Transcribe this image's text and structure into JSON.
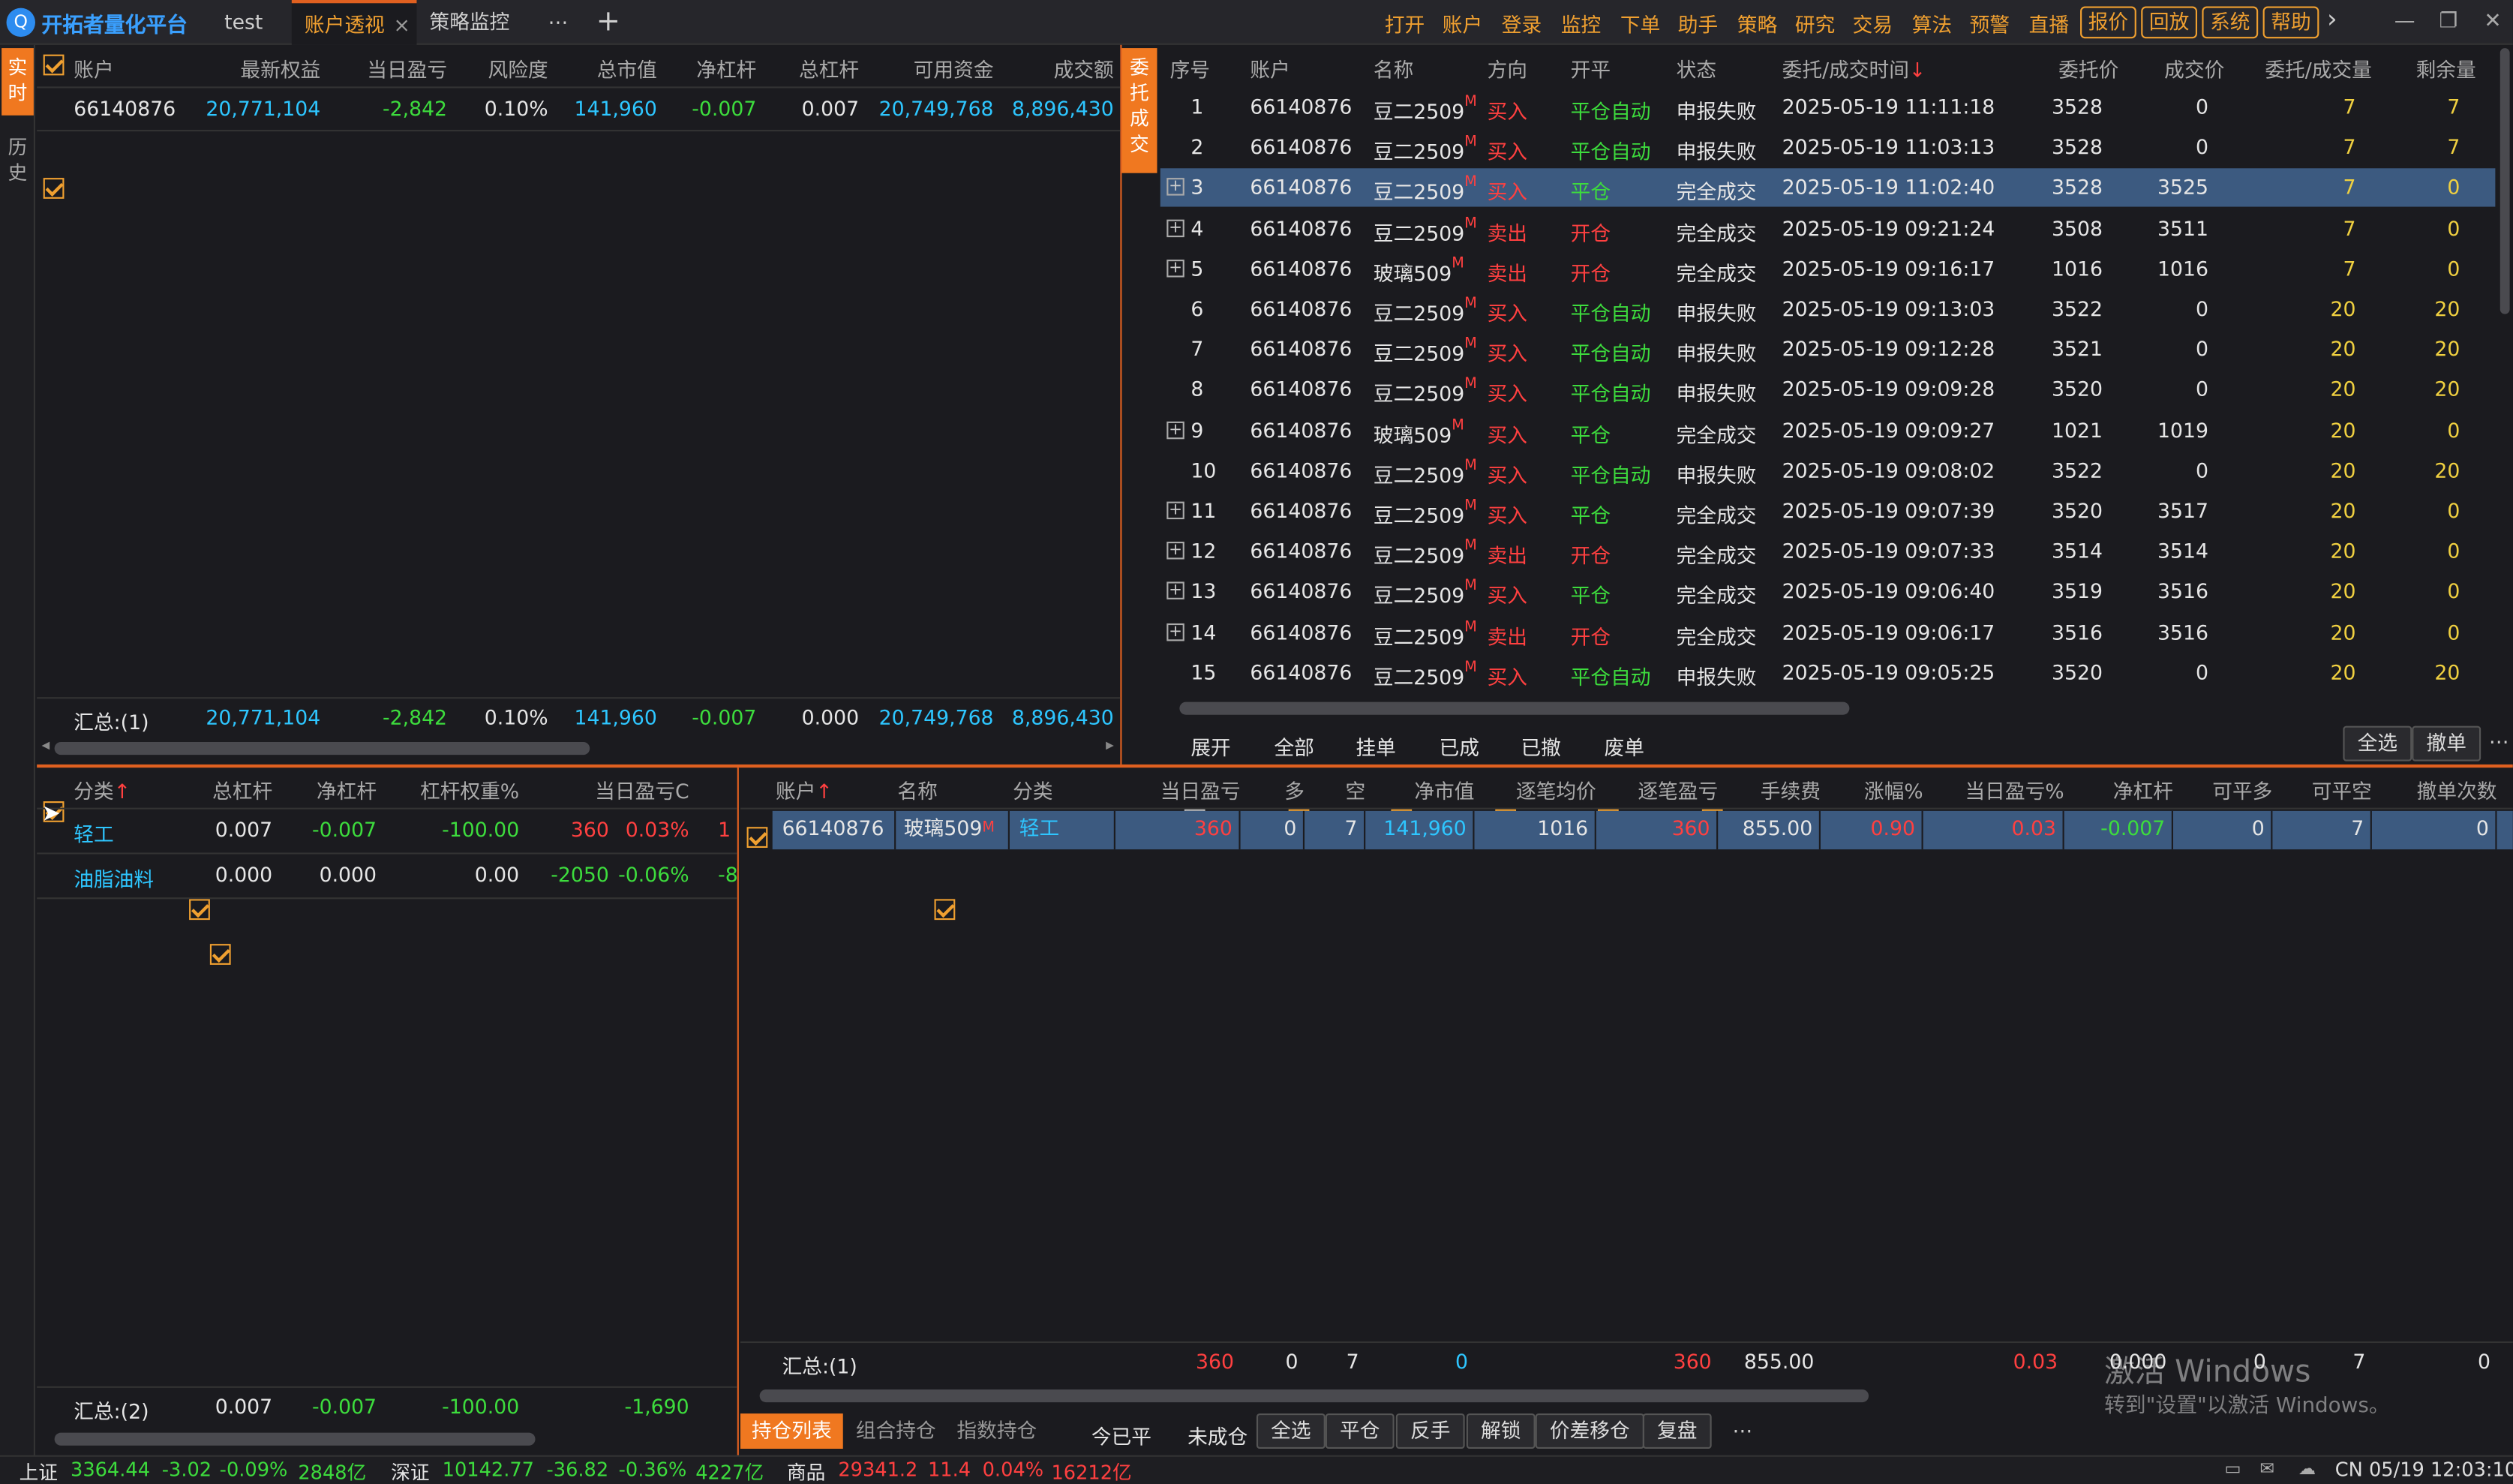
{
  "app": {
    "title": "开拓者量化平台",
    "logo_glyph": "Q"
  },
  "tabs": [
    {
      "label": "test"
    },
    {
      "label": "账户透视",
      "active": true,
      "close": "×"
    },
    {
      "label": "策略监控"
    }
  ],
  "tab_more": "⋯",
  "tab_add": "+",
  "menu": [
    "打开",
    "账户",
    "登录",
    "监控",
    "下单",
    "助手",
    "策略",
    "研究",
    "交易",
    "算法",
    "预警",
    "直播"
  ],
  "menu_buttons": [
    "报价",
    "回放",
    "系统",
    "帮助"
  ],
  "menu_next": "›",
  "window_controls": {
    "minimize": "—",
    "restore": "❐",
    "close": "✕"
  },
  "side_tabs": {
    "realtime": "实\n时",
    "history": "历\n史",
    "entrust": "委\n托\n成\n交"
  },
  "account_panel": {
    "headers": [
      "账户",
      "最新权益",
      "当日盈亏",
      "风险度",
      "总市值",
      "净杠杆",
      "总杠杆",
      "可用资金",
      "成交额"
    ],
    "rows": [
      [
        "66140876",
        "20,771,104",
        "-2,842",
        "0.10%",
        "141,960",
        "-0.007",
        "0.007",
        "20,749,768",
        "8,896,430"
      ]
    ],
    "summary": [
      "汇总:(1)",
      "20,771,104",
      "-2,842",
      "0.10%",
      "141,960",
      "-0.007",
      "0.000",
      "20,749,768",
      "8,896,430"
    ]
  },
  "orders_panel": {
    "headers": [
      "序号",
      "账户",
      "名称",
      "方向",
      "开平",
      "状态",
      "委托/成交时间",
      "委托价",
      "成交价",
      "委托/成交量",
      "剩余量"
    ],
    "sort_mark": "↓",
    "market_mark": "M",
    "rows": [
      {
        "no": "1",
        "acct": "66140876",
        "name": "豆二2509",
        "dir": "买入",
        "oc": "平仓自动",
        "status": "申报失败",
        "time": "2025-05-19 11:11:18",
        "price": "3528",
        "fill": "0",
        "qty": "7",
        "left": "7",
        "exp": false
      },
      {
        "no": "2",
        "acct": "66140876",
        "name": "豆二2509",
        "dir": "买入",
        "oc": "平仓自动",
        "status": "申报失败",
        "time": "2025-05-19 11:03:13",
        "price": "3528",
        "fill": "0",
        "qty": "7",
        "left": "7",
        "exp": false
      },
      {
        "no": "3",
        "acct": "66140876",
        "name": "豆二2509",
        "dir": "买入",
        "oc": "平仓",
        "status": "完全成交",
        "time": "2025-05-19 11:02:40",
        "price": "3528",
        "fill": "3525",
        "qty": "7",
        "left": "0",
        "exp": true,
        "sel": true
      },
      {
        "no": "4",
        "acct": "66140876",
        "name": "豆二2509",
        "dir": "卖出",
        "oc": "开仓",
        "status": "完全成交",
        "time": "2025-05-19 09:21:24",
        "price": "3508",
        "fill": "3511",
        "qty": "7",
        "left": "0",
        "exp": true
      },
      {
        "no": "5",
        "acct": "66140876",
        "name": "玻璃509",
        "dir": "卖出",
        "oc": "开仓",
        "status": "完全成交",
        "time": "2025-05-19 09:16:17",
        "price": "1016",
        "fill": "1016",
        "qty": "7",
        "left": "0",
        "exp": true
      },
      {
        "no": "6",
        "acct": "66140876",
        "name": "豆二2509",
        "dir": "买入",
        "oc": "平仓自动",
        "status": "申报失败",
        "time": "2025-05-19 09:13:03",
        "price": "3522",
        "fill": "0",
        "qty": "20",
        "left": "20",
        "exp": false
      },
      {
        "no": "7",
        "acct": "66140876",
        "name": "豆二2509",
        "dir": "买入",
        "oc": "平仓自动",
        "status": "申报失败",
        "time": "2025-05-19 09:12:28",
        "price": "3521",
        "fill": "0",
        "qty": "20",
        "left": "20",
        "exp": false
      },
      {
        "no": "8",
        "acct": "66140876",
        "name": "豆二2509",
        "dir": "买入",
        "oc": "平仓自动",
        "status": "申报失败",
        "time": "2025-05-19 09:09:28",
        "price": "3520",
        "fill": "0",
        "qty": "20",
        "left": "20",
        "exp": false
      },
      {
        "no": "9",
        "acct": "66140876",
        "name": "玻璃509",
        "dir": "买入",
        "oc": "平仓",
        "status": "完全成交",
        "time": "2025-05-19 09:09:27",
        "price": "1021",
        "fill": "1019",
        "qty": "20",
        "left": "0",
        "exp": true
      },
      {
        "no": "10",
        "acct": "66140876",
        "name": "豆二2509",
        "dir": "买入",
        "oc": "平仓自动",
        "status": "申报失败",
        "time": "2025-05-19 09:08:02",
        "price": "3522",
        "fill": "0",
        "qty": "20",
        "left": "20",
        "exp": false
      },
      {
        "no": "11",
        "acct": "66140876",
        "name": "豆二2509",
        "dir": "买入",
        "oc": "平仓",
        "status": "完全成交",
        "time": "2025-05-19 09:07:39",
        "price": "3520",
        "fill": "3517",
        "qty": "20",
        "left": "0",
        "exp": true
      },
      {
        "no": "12",
        "acct": "66140876",
        "name": "豆二2509",
        "dir": "卖出",
        "oc": "开仓",
        "status": "完全成交",
        "time": "2025-05-19 09:07:33",
        "price": "3514",
        "fill": "3514",
        "qty": "20",
        "left": "0",
        "exp": true
      },
      {
        "no": "13",
        "acct": "66140876",
        "name": "豆二2509",
        "dir": "买入",
        "oc": "平仓",
        "status": "完全成交",
        "time": "2025-05-19 09:06:40",
        "price": "3519",
        "fill": "3516",
        "qty": "20",
        "left": "0",
        "exp": true
      },
      {
        "no": "14",
        "acct": "66140876",
        "name": "豆二2509",
        "dir": "卖出",
        "oc": "开仓",
        "status": "完全成交",
        "time": "2025-05-19 09:06:17",
        "price": "3516",
        "fill": "3516",
        "qty": "20",
        "left": "0",
        "exp": true
      },
      {
        "no": "15",
        "acct": "66140876",
        "name": "豆二2509",
        "dir": "买入",
        "oc": "平仓自动",
        "status": "申报失败",
        "time": "2025-05-19 09:05:25",
        "price": "3520",
        "fill": "0",
        "qty": "20",
        "left": "20",
        "exp": false
      }
    ],
    "filters": [
      {
        "label": "展开",
        "checked": false
      },
      {
        "label": "全部",
        "checked": true
      },
      {
        "label": "挂单",
        "checked": true
      },
      {
        "label": "已成",
        "checked": true
      },
      {
        "label": "已撤",
        "checked": true
      },
      {
        "label": "废单",
        "checked": true
      }
    ],
    "select_all": "全选",
    "cancel": "撤单",
    "more": "⋯"
  },
  "category_panel": {
    "headers": [
      "分类",
      "总杠杆",
      "净杠杆",
      "杠杆权重%",
      "当日盈亏C"
    ],
    "sort_mark": "↑",
    "rows": [
      [
        "轻工",
        "0.007",
        "-0.007",
        "-100.00",
        "360",
        "0.03%",
        "1"
      ],
      [
        "油脂油料",
        "0.000",
        "0.000",
        "0.00",
        "-2050",
        "-0.06%",
        "-8"
      ]
    ],
    "summary": [
      "汇总:(2)",
      "0.007",
      "-0.007",
      "-100.00",
      "-1,690"
    ]
  },
  "positions_panel": {
    "headers": [
      "账户",
      "名称",
      "分类",
      "当日盈亏",
      "多",
      "空",
      "净市值",
      "逐笔均价",
      "逐笔盈亏",
      "手续费",
      "涨幅%",
      "当日盈亏%",
      "净杠杆",
      "可平多",
      "可平空",
      "撤单次数"
    ],
    "sort_mark": "↑",
    "market_mark": "M",
    "rows": [
      [
        "66140876",
        "玻璃509",
        "轻工",
        "360",
        "0",
        "7",
        "141,960",
        "1016",
        "360",
        "855.00",
        "0.90",
        "0.03",
        "-0.007",
        "0",
        "7",
        "0"
      ]
    ],
    "summary": {
      "label": "汇总:(1)",
      "pnl": "360",
      "long": "0",
      "short": "7",
      "mv": "0",
      "trade_pnl": "360",
      "fee": "855.00",
      "pnl_pct": "0.03",
      "lev": "0.000",
      "close_long": "0",
      "close_short": "7",
      "cancels": "0"
    },
    "bottom_tabs": [
      "持仓列表",
      "组合持仓",
      "指数持仓"
    ],
    "bottom_checks": [
      {
        "label": "今已平",
        "checked": false
      },
      {
        "label": "未成仓",
        "checked": false
      }
    ],
    "bottom_buttons": [
      "全选",
      "平仓",
      "反手",
      "解锁",
      "价差移仓",
      "复盘"
    ],
    "bottom_more": "⋯"
  },
  "watermark": {
    "line1": "激活 Windows",
    "line2": "转到\"设置\"以激活 Windows。"
  },
  "status": {
    "sh": {
      "label": "上证",
      "price": "3364.44",
      "chg": "-3.02",
      "pct": "-0.09%",
      "vol": "2848亿"
    },
    "sz": {
      "label": "深证",
      "price": "10142.77",
      "chg": "-36.82",
      "pct": "-0.36%",
      "vol": "4227亿"
    },
    "co": {
      "label": "商品",
      "price": "29341.2",
      "chg": "11.4",
      "pct": "0.04%",
      "vol": "16212亿"
    },
    "clock": "CN 05/19 12:03:10"
  },
  "colors": {
    "accent": "#f0a030",
    "up": "#ff4040",
    "down": "#3ddc3d",
    "value": "#2ec6ff",
    "selected": "#3c5a80"
  }
}
